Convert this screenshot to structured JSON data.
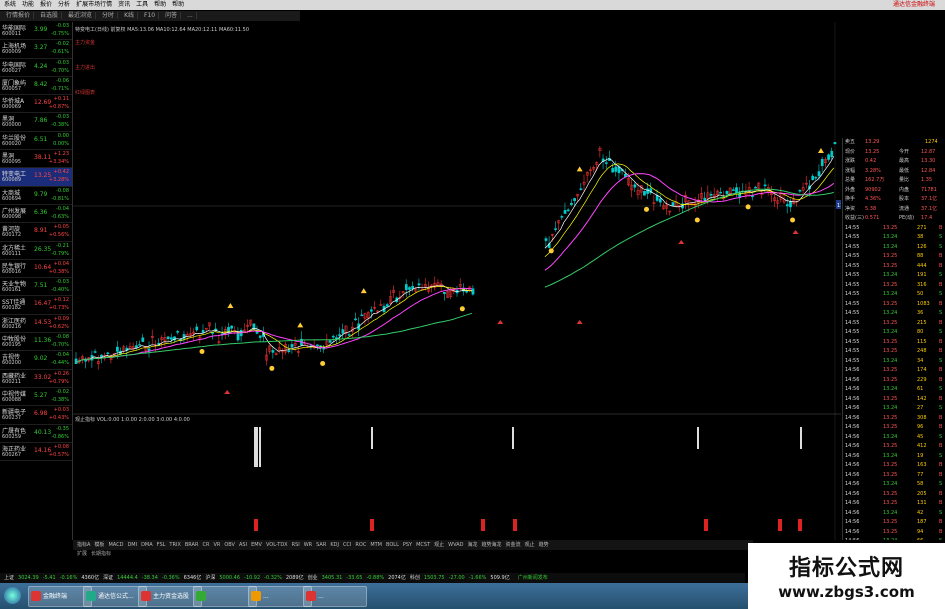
{
  "menubar": {
    "items": [
      "系统",
      "功能",
      "报价",
      "分析",
      "扩展市场行情",
      "资讯",
      "工具",
      "帮助",
      "帮助"
    ],
    "title": "通达信金融终端"
  },
  "tabs": [
    "行情报价",
    "自选股",
    "最近浏览",
    "分时",
    "K线",
    "F10",
    "问答",
    "..."
  ],
  "chart_toolbar": [
    "分时",
    "1分钟",
    "5分钟",
    "15分钟",
    "30分钟",
    "60分钟",
    "日线",
    "周线",
    "月线",
    "季线",
    "年线"
  ],
  "watchlist": [
    {
      "name": "华能国际",
      "code": "600011",
      "price": "3.99",
      "chg": "-0.03",
      "pct": "-0.75%",
      "dir": "dn"
    },
    {
      "name": "上海机场",
      "code": "600009",
      "price": "3.27",
      "chg": "-0.02",
      "pct": "-0.61%",
      "dir": "dn"
    },
    {
      "name": "华电国际",
      "code": "600027",
      "price": "4.24",
      "chg": "-0.03",
      "pct": "-0.70%",
      "dir": "dn"
    },
    {
      "name": "厦门象屿",
      "code": "600057",
      "price": "8.42",
      "chg": "-0.06",
      "pct": "-0.71%",
      "dir": "dn"
    },
    {
      "name": "华侨城A",
      "code": "000069",
      "price": "12.69",
      "chg": "+0.11",
      "pct": "+0.87%",
      "dir": "up"
    },
    {
      "name": "黑洞",
      "code": "600000",
      "price": "7.86",
      "chg": "-0.03",
      "pct": "-0.38%",
      "dir": "dn"
    },
    {
      "name": "华兰股份",
      "code": "600020",
      "price": "6.51",
      "chg": "0.00",
      "pct": "0.00%",
      "dir": "dn"
    },
    {
      "name": "黑洞",
      "code": "600095",
      "price": "38.11",
      "chg": "+1.23",
      "pct": "+3.34%",
      "dir": "up"
    },
    {
      "name": "特变电工",
      "code": "600089",
      "price": "13.25",
      "chg": "+0.42",
      "pct": "+3.28%",
      "dir": "up",
      "selected": true
    },
    {
      "name": "大商城",
      "code": "600694",
      "price": "9.79",
      "chg": "-0.08",
      "pct": "-0.81%",
      "dir": "dn"
    },
    {
      "name": "广州发展",
      "code": "600098",
      "price": "6.36",
      "chg": "-0.04",
      "pct": "-0.63%",
      "dir": "dn"
    },
    {
      "name": "黄河旋",
      "code": "600172",
      "price": "8.91",
      "chg": "+0.05",
      "pct": "+0.56%",
      "dir": "up"
    },
    {
      "name": "北方稀土",
      "code": "600111",
      "price": "26.35",
      "chg": "-0.21",
      "pct": "-0.79%",
      "dir": "dn"
    },
    {
      "name": "民生银行",
      "code": "600016",
      "price": "10.64",
      "chg": "+0.04",
      "pct": "+0.38%",
      "dir": "up"
    },
    {
      "name": "天业生物",
      "code": "600161",
      "price": "7.51",
      "chg": "-0.03",
      "pct": "-0.40%",
      "dir": "dn"
    },
    {
      "name": "SST佳通",
      "code": "600182",
      "price": "16.47",
      "chg": "+0.12",
      "pct": "+0.73%",
      "dir": "up"
    },
    {
      "name": "浙江医药",
      "code": "600216",
      "price": "14.53",
      "chg": "+0.09",
      "pct": "+0.62%",
      "dir": "up"
    },
    {
      "name": "中牧股份",
      "code": "600195",
      "price": "11.36",
      "chg": "-0.08",
      "pct": "-0.70%",
      "dir": "dn"
    },
    {
      "name": "吉视传",
      "code": "600200",
      "price": "9.02",
      "chg": "-0.04",
      "pct": "-0.44%",
      "dir": "dn"
    },
    {
      "name": "西藏药业",
      "code": "600211",
      "price": "33.02",
      "chg": "+0.26",
      "pct": "+0.79%",
      "dir": "up"
    },
    {
      "name": "中视传媒",
      "code": "600088",
      "price": "5.27",
      "chg": "-0.02",
      "pct": "-0.38%",
      "dir": "dn"
    },
    {
      "name": "新疆电子",
      "code": "600237",
      "price": "6.98",
      "chg": "+0.03",
      "pct": "+0.43%",
      "dir": "up"
    },
    {
      "name": "广晟有色",
      "code": "600259",
      "price": "40.13",
      "chg": "-0.35",
      "pct": "-0.86%",
      "dir": "dn"
    },
    {
      "name": "海正药业",
      "code": "600267",
      "price": "14.16",
      "chg": "+0.08",
      "pct": "+0.57%",
      "dir": "up"
    }
  ],
  "chart": {
    "header": "特变电工(日线) 前复权 MA5:13.06 MA10:12.64 MA20:12.11 MA60:11.50",
    "indicator_header": "观止指标 VOL:0.00 1:0.00 2:0.00 3:0.00 4:0.00",
    "side_labels": [
      "主力资金",
      "主力进出",
      "红绿图表"
    ],
    "price_ticks": [
      "13.50",
      "13.00",
      "12.50",
      "12.00",
      "11.50",
      "11.00",
      "10.50",
      "10.00",
      "9.50",
      "9.00",
      "8.50",
      "8.00",
      "7.50",
      "7.00",
      "6.50"
    ],
    "current_price_tag": "11.12",
    "vol_ticks": [
      "100.00",
      "80.00",
      "60.00",
      "40.00",
      "20.00"
    ],
    "colors": {
      "up": "#ff3333",
      "down": "#00cccc",
      "ma5": "#ffffff",
      "ma10": "#ffff00",
      "ma20": "#ff44ff",
      "ma60": "#33cc66"
    }
  },
  "quote_panel": {
    "top": [
      {
        "k": "卖五",
        "v": "13.29",
        "v2": "1274"
      },
      {
        "k": "现价",
        "v": "13.25",
        "k2": "今开",
        "v3": "12.87"
      },
      {
        "k": "涨跌",
        "v": "0.42",
        "k2": "最高",
        "v3": "13.30"
      },
      {
        "k": "涨幅",
        "v": "3.28%",
        "k2": "最低",
        "v3": "12.84"
      },
      {
        "k": "总量",
        "v": "162.7万",
        "k2": "量比",
        "v3": "1.35"
      },
      {
        "k": "外盘",
        "v": "90902",
        "k2": "内盘",
        "v3": "71781"
      },
      {
        "k": "换手",
        "v": "4.36%",
        "k2": "股本",
        "v3": "37.1亿"
      },
      {
        "k": "净资",
        "v": "5.38",
        "k2": "流通",
        "v3": "37.1亿"
      },
      {
        "k": "收益(三)",
        "v": "0.571",
        "k2": "PE(动)",
        "v3": "17.4"
      }
    ],
    "ticks": [
      {
        "t": "14:55",
        "p": "13.25",
        "v": "271",
        "c": "up"
      },
      {
        "t": "14:55",
        "p": "13.24",
        "v": "38",
        "c": "dn"
      },
      {
        "t": "14:55",
        "p": "13.24",
        "v": "126",
        "c": "dn"
      },
      {
        "t": "14:55",
        "p": "13.25",
        "v": "88",
        "c": "up"
      },
      {
        "t": "14:55",
        "p": "13.25",
        "v": "444",
        "c": "up"
      },
      {
        "t": "14:55",
        "p": "13.24",
        "v": "191",
        "c": "dn"
      },
      {
        "t": "14:55",
        "p": "13.25",
        "v": "316",
        "c": "up"
      },
      {
        "t": "14:55",
        "p": "13.24",
        "v": "50",
        "c": "dn"
      },
      {
        "t": "14:55",
        "p": "13.25",
        "v": "1083",
        "c": "up"
      },
      {
        "t": "14:55",
        "p": "13.24",
        "v": "36",
        "c": "dn"
      },
      {
        "t": "14:55",
        "p": "13.25",
        "v": "215",
        "c": "up"
      },
      {
        "t": "14:55",
        "p": "13.24",
        "v": "80",
        "c": "dn"
      },
      {
        "t": "14:55",
        "p": "13.25",
        "v": "115",
        "c": "up"
      },
      {
        "t": "14:55",
        "p": "13.25",
        "v": "248",
        "c": "up"
      },
      {
        "t": "14:55",
        "p": "13.24",
        "v": "34",
        "c": "dn"
      },
      {
        "t": "14:56",
        "p": "13.25",
        "v": "174",
        "c": "up"
      },
      {
        "t": "14:56",
        "p": "13.25",
        "v": "229",
        "c": "up"
      },
      {
        "t": "14:56",
        "p": "13.24",
        "v": "61",
        "c": "dn"
      },
      {
        "t": "14:56",
        "p": "13.25",
        "v": "142",
        "c": "up"
      },
      {
        "t": "14:56",
        "p": "13.24",
        "v": "27",
        "c": "dn"
      },
      {
        "t": "14:56",
        "p": "13.25",
        "v": "308",
        "c": "up"
      },
      {
        "t": "14:56",
        "p": "13.25",
        "v": "96",
        "c": "up"
      },
      {
        "t": "14:56",
        "p": "13.24",
        "v": "45",
        "c": "dn"
      },
      {
        "t": "14:56",
        "p": "13.25",
        "v": "412",
        "c": "up"
      },
      {
        "t": "14:56",
        "p": "13.24",
        "v": "19",
        "c": "dn"
      },
      {
        "t": "14:56",
        "p": "13.25",
        "v": "163",
        "c": "up"
      },
      {
        "t": "14:56",
        "p": "13.25",
        "v": "77",
        "c": "up"
      },
      {
        "t": "14:56",
        "p": "13.24",
        "v": "58",
        "c": "dn"
      },
      {
        "t": "14:56",
        "p": "13.25",
        "v": "205",
        "c": "up"
      },
      {
        "t": "14:56",
        "p": "13.25",
        "v": "131",
        "c": "up"
      },
      {
        "t": "14:56",
        "p": "13.24",
        "v": "42",
        "c": "dn"
      },
      {
        "t": "14:56",
        "p": "13.25",
        "v": "187",
        "c": "up"
      },
      {
        "t": "14:56",
        "p": "13.25",
        "v": "94",
        "c": "up"
      },
      {
        "t": "14:56",
        "p": "13.24",
        "v": "66",
        "c": "dn"
      },
      {
        "t": "14:56",
        "p": "13.25",
        "v": "253",
        "c": "up"
      },
      {
        "t": "14:56",
        "p": "13.25",
        "v": "118",
        "c": "up"
      },
      {
        "t": "14:56",
        "p": "13.24",
        "v": "29",
        "c": "dn"
      },
      {
        "t": "14:56",
        "p": "13.25",
        "v": "176",
        "c": "up"
      },
      {
        "t": "14:56",
        "p": "13.25",
        "v": "84",
        "c": "up"
      },
      {
        "t": "14:56",
        "p": "13.24",
        "v": "53",
        "c": "dn"
      },
      {
        "t": "14:56",
        "p": "13.25",
        "v": "301",
        "c": "up"
      }
    ]
  },
  "indicator_tabs": [
    "指标A",
    "模板",
    "MACD",
    "DMI",
    "DMA",
    "FSL",
    "TRIX",
    "BRAR",
    "CR",
    "VR",
    "OBV",
    "ASI",
    "EMV",
    "VOL-TDX",
    "RSI",
    "WR",
    "SAR",
    "KDJ",
    "CCI",
    "ROC",
    "MTM",
    "BOLL",
    "PSY",
    "MCST",
    "观止",
    "WVAD",
    "海龙",
    "趋势海龙",
    "资金流",
    "观止",
    "趋势"
  ],
  "sub_tabs": [
    "扩展",
    "长期指标"
  ],
  "index_bar": [
    {
      "name": "上证",
      "val": "3024.39",
      "chg": "-5.41",
      "pct": "-0.16%",
      "amt": "4360亿",
      "dir": "dn"
    },
    {
      "name": "深证",
      "val": "14444.4",
      "chg": "-38.34",
      "pct": "-0.36%",
      "amt": "6346亿",
      "dir": "dn"
    },
    {
      "name": "沪深",
      "val": "5000.46",
      "chg": "-10.92",
      "pct": "-0.32%",
      "amt": "2089亿",
      "dir": "dn"
    },
    {
      "name": "创业",
      "val": "3405.31",
      "chg": "-33.65",
      "pct": "-0.88%",
      "amt": "2074亿",
      "dir": "dn"
    },
    {
      "name": "科创",
      "val": "1503.75",
      "chg": "-27.00",
      "pct": "-1.66%",
      "amt": "509.9亿",
      "dir": "dn"
    },
    {
      "name": "",
      "val": "广州新闻发布",
      "chg": "",
      "pct": "",
      "amt": "",
      "dir": "dn"
    }
  ],
  "taskbar": {
    "buttons": [
      "金融终端",
      "通达信公式...",
      "主力资金选股",
      "",
      "...",
      "..."
    ]
  },
  "watermark": {
    "line1": "指标公式网",
    "line2": "www.zbgs3.com"
  }
}
